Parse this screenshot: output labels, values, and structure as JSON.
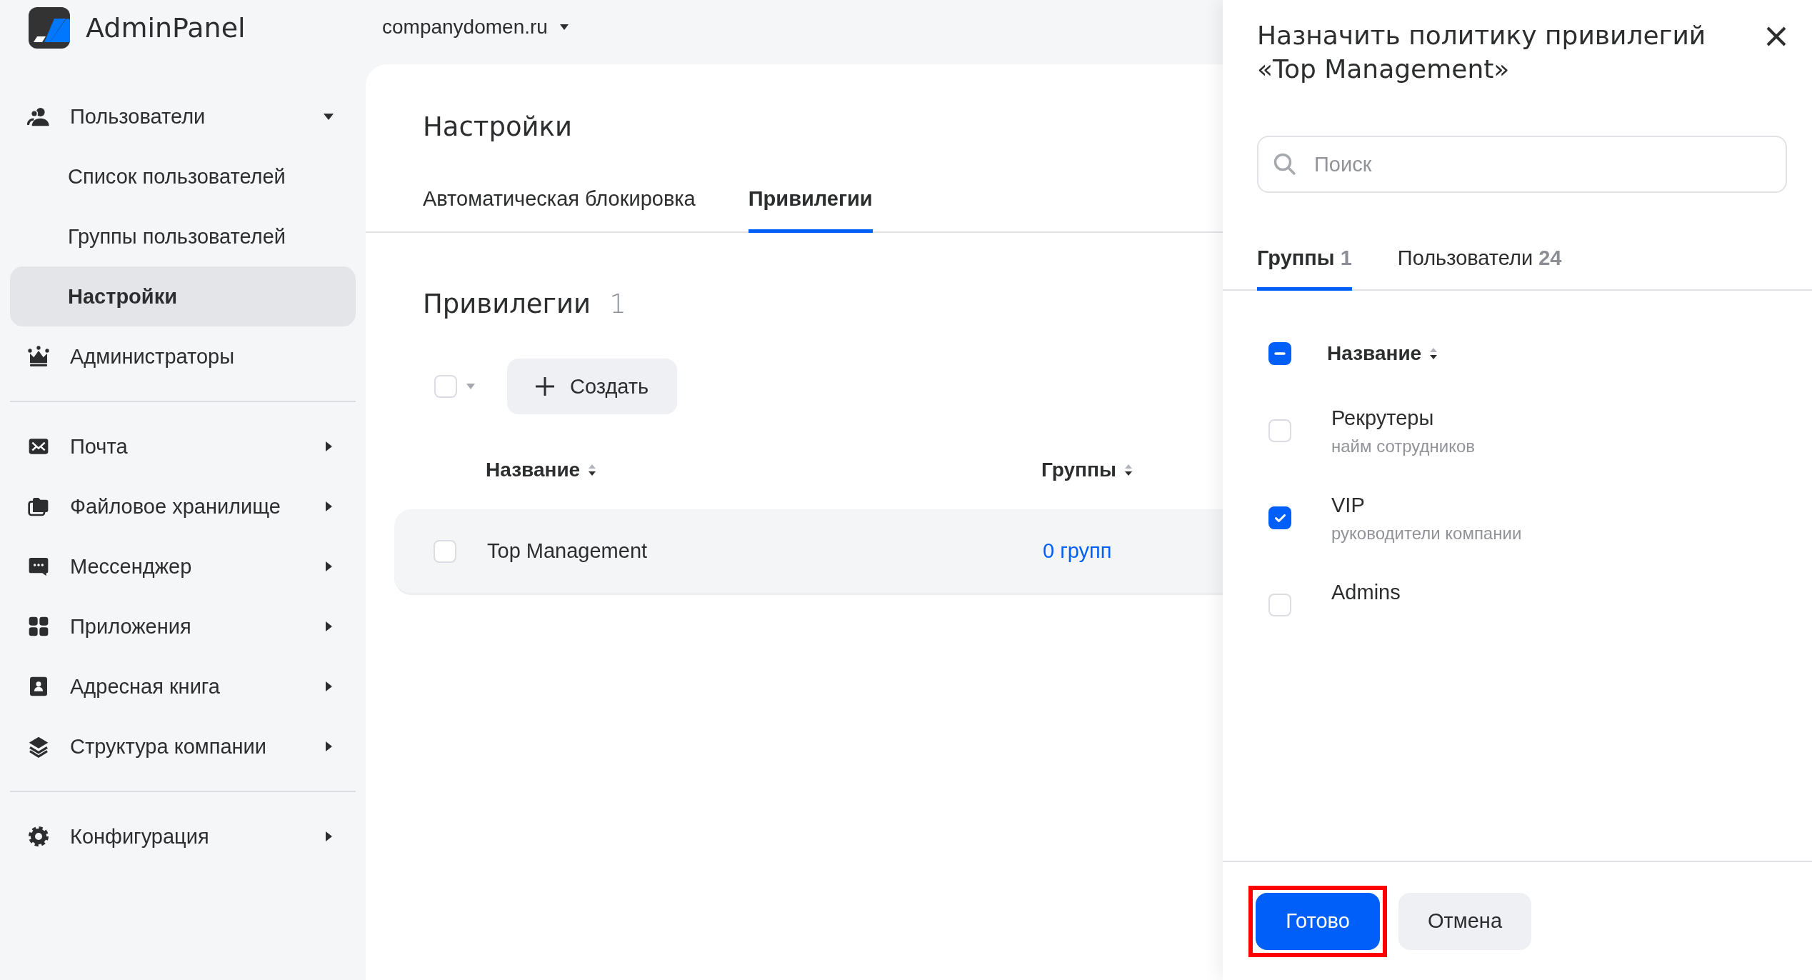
{
  "brand": {
    "name": "AdminPanel"
  },
  "sidebar": {
    "sections": [
      {
        "items": [
          {
            "label": "Пользователи",
            "selected": false,
            "expanded": true,
            "children": [
              {
                "label": "Список пользователей",
                "selected": false
              },
              {
                "label": "Группы пользователей",
                "selected": false
              },
              {
                "label": "Настройки",
                "selected": true
              }
            ]
          },
          {
            "label": "Администраторы",
            "selected": false
          }
        ]
      },
      {
        "items": [
          {
            "label": "Почта",
            "selected": false,
            "expanded": false
          },
          {
            "label": "Файловое хранилище",
            "selected": false,
            "expanded": false
          },
          {
            "label": "Мессенджер",
            "selected": false,
            "expanded": false
          },
          {
            "label": "Приложения",
            "selected": false,
            "expanded": false
          },
          {
            "label": "Адресная книга",
            "selected": false,
            "expanded": false
          },
          {
            "label": "Структура компании",
            "selected": false,
            "expanded": false
          }
        ]
      },
      {
        "items": [
          {
            "label": "Конфигурация",
            "selected": false,
            "expanded": false
          }
        ]
      }
    ]
  },
  "domain": {
    "label": "companydomen.ru"
  },
  "main": {
    "title": "Настройки",
    "tabs": [
      {
        "label": "Автоматическая блокировка",
        "selected": false
      },
      {
        "label": "Привилегии",
        "selected": true
      }
    ],
    "section": {
      "title": "Привилегии",
      "count": "1"
    },
    "select_all": {
      "checked": false
    },
    "create_button": {
      "label": "Создать"
    },
    "table": {
      "columns": [
        "Название",
        "Группы"
      ],
      "rows": [
        {
          "checked": false,
          "cells": [
            "Top Management",
            "0 групп"
          ]
        }
      ]
    }
  },
  "drawer": {
    "title": "Назначить политику привилегий «Top Management»",
    "search": {
      "placeholder": "Поиск"
    },
    "tabs": [
      {
        "label": "Группы",
        "count": "1",
        "selected": true
      },
      {
        "label": "Пользователи",
        "count": "24",
        "selected": false
      }
    ],
    "header": {
      "label": "Название",
      "indeterminate": true
    },
    "items": [
      {
        "name": "Рекрутеры",
        "description": "найм сотрудников",
        "checked": false
      },
      {
        "name": "VIP",
        "description": "руководители компании",
        "checked": true
      },
      {
        "name": "Admins",
        "checked": false
      }
    ],
    "buttons": [
      {
        "label": "Готово",
        "kind": "primary",
        "highlighted": true
      },
      {
        "label": "Отмена",
        "kind": "secondary",
        "highlighted": false
      }
    ]
  }
}
